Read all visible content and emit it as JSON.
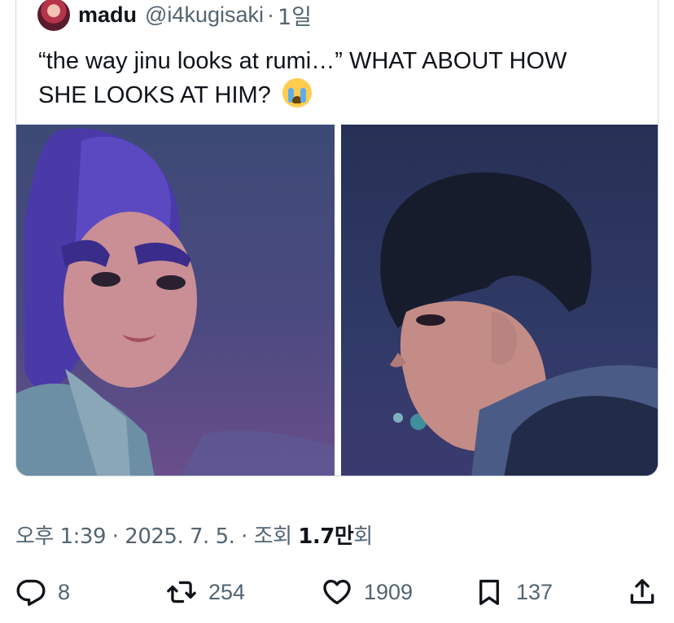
{
  "quoted_post": {
    "author_name": "madu",
    "author_handle": "@i4kugisaki",
    "separator": "·",
    "relative_time": "1일",
    "text_line1": "“the way jinu looks at rumi…” WHAT ABOUT HOW",
    "text_line2": "SHE LOOKS AT HIM?",
    "emoji": "loudly-crying-face"
  },
  "meta": {
    "time": "오후 1:39",
    "date": "2025. 7. 5.",
    "views_label": "조회",
    "views_count": "1.7만",
    "views_suffix": "회",
    "separator": "·"
  },
  "actions": {
    "replies": "8",
    "reposts": "254",
    "likes": "1909",
    "bookmarks": "137"
  },
  "icons": [
    "reply-icon",
    "repost-icon",
    "like-icon",
    "bookmark-icon",
    "share-icon"
  ],
  "colors": {
    "secondary_text": "#536471",
    "border": "#cfd9de",
    "text": "#0f1419"
  }
}
